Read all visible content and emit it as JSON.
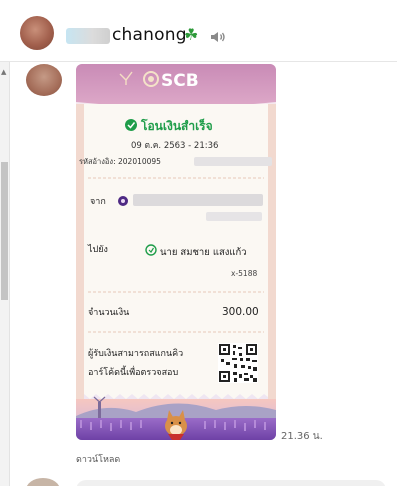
{
  "header": {
    "chat_name": "chanong",
    "clover": "☘",
    "speaker_icon": "speaker-icon"
  },
  "receipt": {
    "bank": "SCB",
    "status": "โอนเงินสำเร็จ",
    "date": "09 ต.ค. 2563 - 21:36",
    "ref_label": "รหัสอ้างอิง: 202010095",
    "from_label": "จาก",
    "to_label": "ไปยัง",
    "to_name": "นาย สมชาย แสงแก้ว",
    "to_account": "x-5188",
    "amount_label": "จำนวนเงิน",
    "amount": "300.00",
    "qr_note_line1": "ผู้รับเงินสามารถสแกนคิว",
    "qr_note_line2": "อาร์โค้ดนี้เพื่อตรวจสอบ",
    "colors": {
      "header": "#cf8bb8",
      "brand": "#4e2a84",
      "success": "#1f9d4a",
      "panel": "#fbf8f3"
    }
  },
  "message": {
    "time": "21.36 น.",
    "download": "ดาวน์โหลด"
  }
}
